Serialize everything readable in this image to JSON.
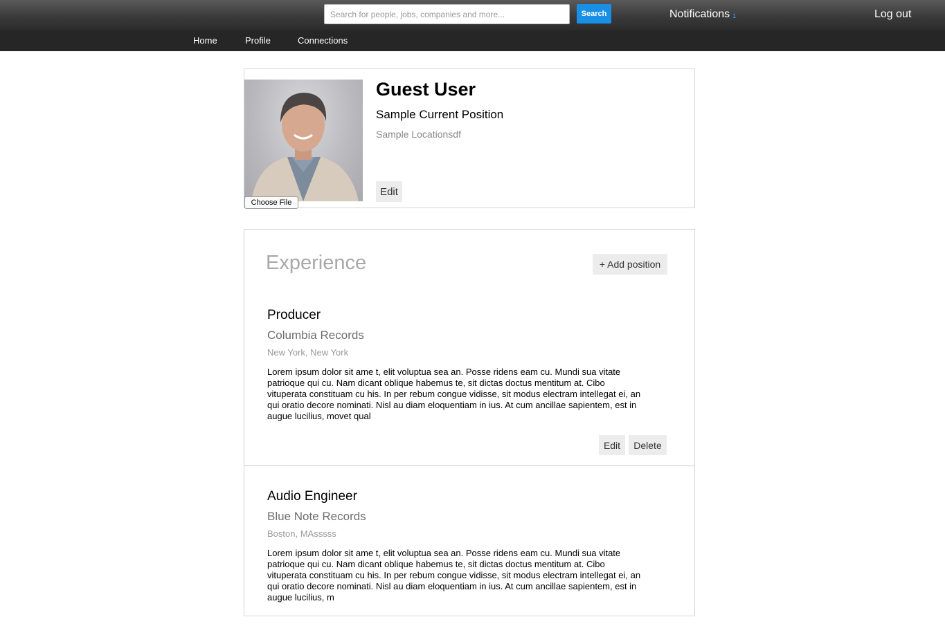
{
  "header": {
    "search_placeholder": "Search for people, jobs, companies and more...",
    "search_button": "Search",
    "notifications_label": "Notifications",
    "notifications_count": "1",
    "logout_label": "Log out"
  },
  "nav": {
    "items": [
      {
        "label": "Home"
      },
      {
        "label": "Profile"
      },
      {
        "label": "Connections"
      }
    ]
  },
  "profile": {
    "name": "Guest User",
    "position": "Sample Current Position",
    "location": "Sample Locationsdf",
    "edit_label": "Edit",
    "choose_file_label": "Choose File"
  },
  "experience": {
    "title": "Experience",
    "add_label": "+ Add position",
    "items": [
      {
        "title": "Producer",
        "company": "Columbia Records",
        "location": "New York, New York",
        "description_lines": [
          "Lorem ipsum dolor sit ame t, elit voluptua sea an. Posse ridens eam cu. Mundi sua vitate",
          "patrioque qui cu. Nam dicant oblique habemus te, sit dictas doctus mentitum at. Cibo",
          "vituperata constituam cu his. In per rebum congue vidisse, sit modus electram intellegat ei, an",
          "qui oratio decore nominati. Nisl au diam eloquentiam in ius. At cum ancillae sapientem, est in",
          "augue lucilius, movet qual"
        ],
        "edit_label": "Edit",
        "delete_label": "Delete"
      },
      {
        "title": "Audio Engineer",
        "company": "Blue Note Records",
        "location": "Boston, MAsssss",
        "description_lines": [
          "Lorem ipsum dolor sit ame t, elit voluptua sea an. Posse ridens eam cu. Mundi sua vitate",
          "patrioque qui cu. Nam dicant oblique habemus te, sit dictas doctus mentitum at. Cibo",
          "vituperata constituam cu his. In per rebum congue vidisse, sit modus electram intellegat ei, an",
          "qui oratio decore nominati. Nisl au diam eloquentiam in ius. At cum ancillae sapientem, est in",
          "augue lucilius, m"
        ]
      }
    ]
  }
}
